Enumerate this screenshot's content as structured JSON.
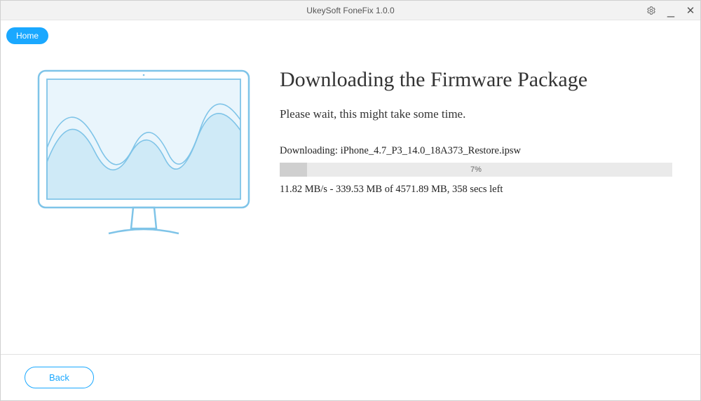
{
  "window": {
    "title": "UkeySoft FoneFix 1.0.0"
  },
  "tabs": {
    "home_label": "Home"
  },
  "main": {
    "heading": "Downloading the Firmware Package",
    "subtext": "Please wait, this might take some time.",
    "download_label": "Downloading: iPhone_4.7_P3_14.0_18A373_Restore.ipsw",
    "progress_percent_text": "7%",
    "progress_percent_value": 7,
    "stats": "11.82 MB/s - 339.53 MB of 4571.89 MB, 358 secs left"
  },
  "footer": {
    "back_label": "Back"
  },
  "colors": {
    "accent": "#1aa8ff",
    "illustration_stroke": "#7fc4e8",
    "illustration_fill": "#cfeaf7"
  }
}
